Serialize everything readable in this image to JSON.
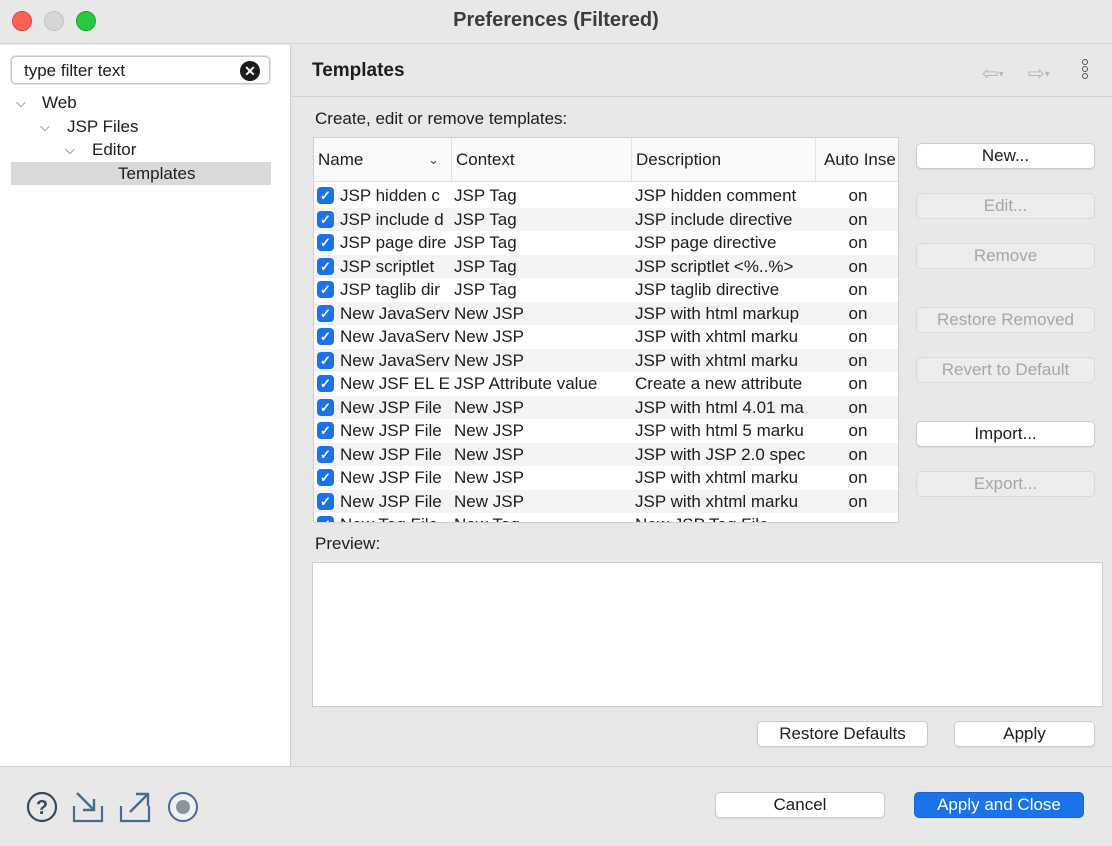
{
  "window": {
    "title": "Preferences (Filtered)"
  },
  "filter": {
    "value": "type filter text",
    "clear_glyph": "✕"
  },
  "tree": {
    "items": [
      {
        "label": "Web",
        "expanded": true
      },
      {
        "label": "JSP Files",
        "expanded": true
      },
      {
        "label": "Editor",
        "expanded": true
      },
      {
        "label": "Templates",
        "selected": true
      }
    ]
  },
  "header": {
    "title": "Templates"
  },
  "main": {
    "create_label": "Create, edit or remove templates:",
    "preview_label": "Preview:",
    "columns": [
      "Name",
      "Context",
      "Description",
      "Auto Inse"
    ],
    "rows": [
      {
        "name": "JSP hidden c",
        "context": "JSP Tag",
        "description": "JSP hidden comment",
        "auto": "on",
        "checked": true
      },
      {
        "name": "JSP include d",
        "context": "JSP Tag",
        "description": "JSP include directive",
        "auto": "on",
        "checked": true
      },
      {
        "name": "JSP page dire",
        "context": "JSP Tag",
        "description": "JSP page directive",
        "auto": "on",
        "checked": true
      },
      {
        "name": "JSP scriptlet",
        "context": "JSP Tag",
        "description": "JSP scriptlet <%..%>",
        "auto": "on",
        "checked": true
      },
      {
        "name": "JSP taglib dir",
        "context": "JSP Tag",
        "description": "JSP taglib directive",
        "auto": "on",
        "checked": true
      },
      {
        "name": "New JavaServ",
        "context": "New JSP",
        "description": "JSP with html markup",
        "auto": "on",
        "checked": true
      },
      {
        "name": "New JavaServ",
        "context": "New JSP",
        "description": "JSP with xhtml marku",
        "auto": "on",
        "checked": true
      },
      {
        "name": "New JavaServ",
        "context": "New JSP",
        "description": "JSP with xhtml marku",
        "auto": "on",
        "checked": true
      },
      {
        "name": "New JSF EL E",
        "context": "JSP Attribute value",
        "description": "Create a new attribute",
        "auto": "on",
        "checked": true
      },
      {
        "name": "New JSP File",
        "context": "New JSP",
        "description": "JSP with html 4.01 ma",
        "auto": "on",
        "checked": true
      },
      {
        "name": "New JSP File",
        "context": "New JSP",
        "description": "JSP with html 5 marku",
        "auto": "on",
        "checked": true
      },
      {
        "name": "New JSP File",
        "context": "New JSP",
        "description": "JSP with JSP 2.0 spec",
        "auto": "on",
        "checked": true
      },
      {
        "name": "New JSP File",
        "context": "New JSP",
        "description": "JSP with xhtml marku",
        "auto": "on",
        "checked": true
      },
      {
        "name": "New JSP File",
        "context": "New JSP",
        "description": "JSP with xhtml marku",
        "auto": "on",
        "checked": true
      },
      {
        "name": "New Tag File",
        "context": "New Tag",
        "description": "New JSP Tag File",
        "auto": "",
        "checked": true
      }
    ],
    "side_buttons": [
      {
        "label": "New...",
        "enabled": true
      },
      {
        "label": "Edit...",
        "enabled": false
      },
      {
        "label": "Remove",
        "enabled": false
      },
      {
        "label": "Restore Removed",
        "enabled": false
      },
      {
        "label": "Revert to Default",
        "enabled": false
      },
      {
        "label": "Import...",
        "enabled": true
      },
      {
        "label": "Export...",
        "enabled": false
      }
    ],
    "restore_defaults_label": "Restore Defaults",
    "apply_label": "Apply"
  },
  "footer": {
    "cancel_label": "Cancel",
    "apply_close_label": "Apply and Close",
    "icons": [
      "help-icon",
      "import-icon",
      "export-icon",
      "record-icon"
    ]
  },
  "colors": {
    "accent": "#1a73e8",
    "close": "#fe5f57",
    "maximize": "#28c840"
  }
}
